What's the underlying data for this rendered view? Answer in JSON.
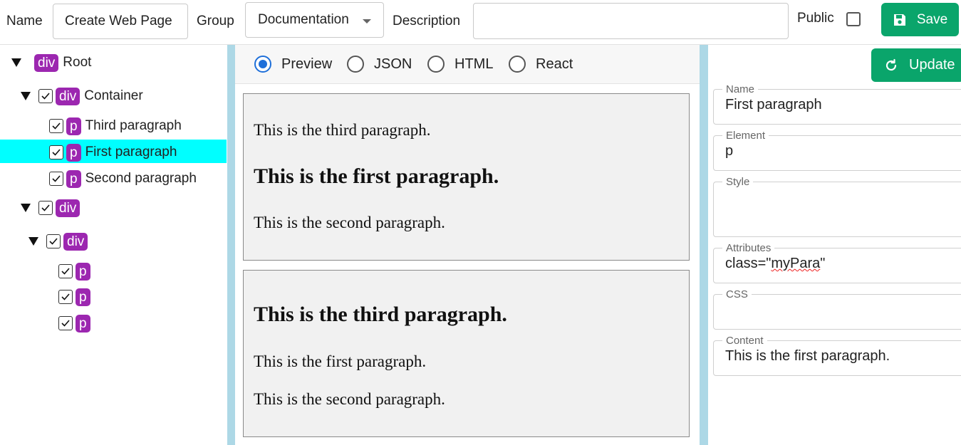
{
  "toolbar": {
    "name_label": "Name",
    "name_value": "Create Web Page",
    "group_label": "Group",
    "group_value": "Documentation",
    "description_label": "Description",
    "description_value": "",
    "public_label": "Public",
    "public_checked": false,
    "save_label": "Save"
  },
  "tree": {
    "root": {
      "tag": "div",
      "label": "Root"
    },
    "container": {
      "tag": "div",
      "label": "Container"
    },
    "third": {
      "tag": "p",
      "label": "Third paragraph"
    },
    "first": {
      "tag": "p",
      "label": "First paragraph"
    },
    "second": {
      "tag": "p",
      "label": "Second paragraph"
    },
    "div2": {
      "tag": "div"
    },
    "div3": {
      "tag": "div"
    },
    "p1": {
      "tag": "p"
    },
    "p2": {
      "tag": "p"
    },
    "p3": {
      "tag": "p"
    }
  },
  "view_modes": {
    "preview": "Preview",
    "json": "JSON",
    "html": "HTML",
    "react": "React",
    "selected": "Preview"
  },
  "preview1": {
    "p1": "This is the third paragraph.",
    "p2": "This is the first paragraph.",
    "p3": "This is the second paragraph."
  },
  "preview2": {
    "p1": "This is the third paragraph.",
    "p2": "This is the first paragraph.",
    "p3": "This is the second paragraph."
  },
  "properties": {
    "update_label": "Update",
    "name_label": "Name",
    "name_value": "First paragraph",
    "element_label": "Element",
    "element_value": "p",
    "style_label": "Style",
    "style_value": "",
    "attributes_label": "Attributes",
    "attributes_prefix": "class=\"",
    "attributes_word": "myPara",
    "attributes_suffix": "\"",
    "css_label": "CSS",
    "css_value": "",
    "content_label": "Content",
    "content_value": "This is the first paragraph."
  },
  "colors": {
    "accent_green": "#0aa56b",
    "tag_purple": "#9c27b0",
    "selection_cyan": "#00ffff",
    "divider_blue": "#add8e6",
    "radio_blue": "#1e6fd9"
  }
}
